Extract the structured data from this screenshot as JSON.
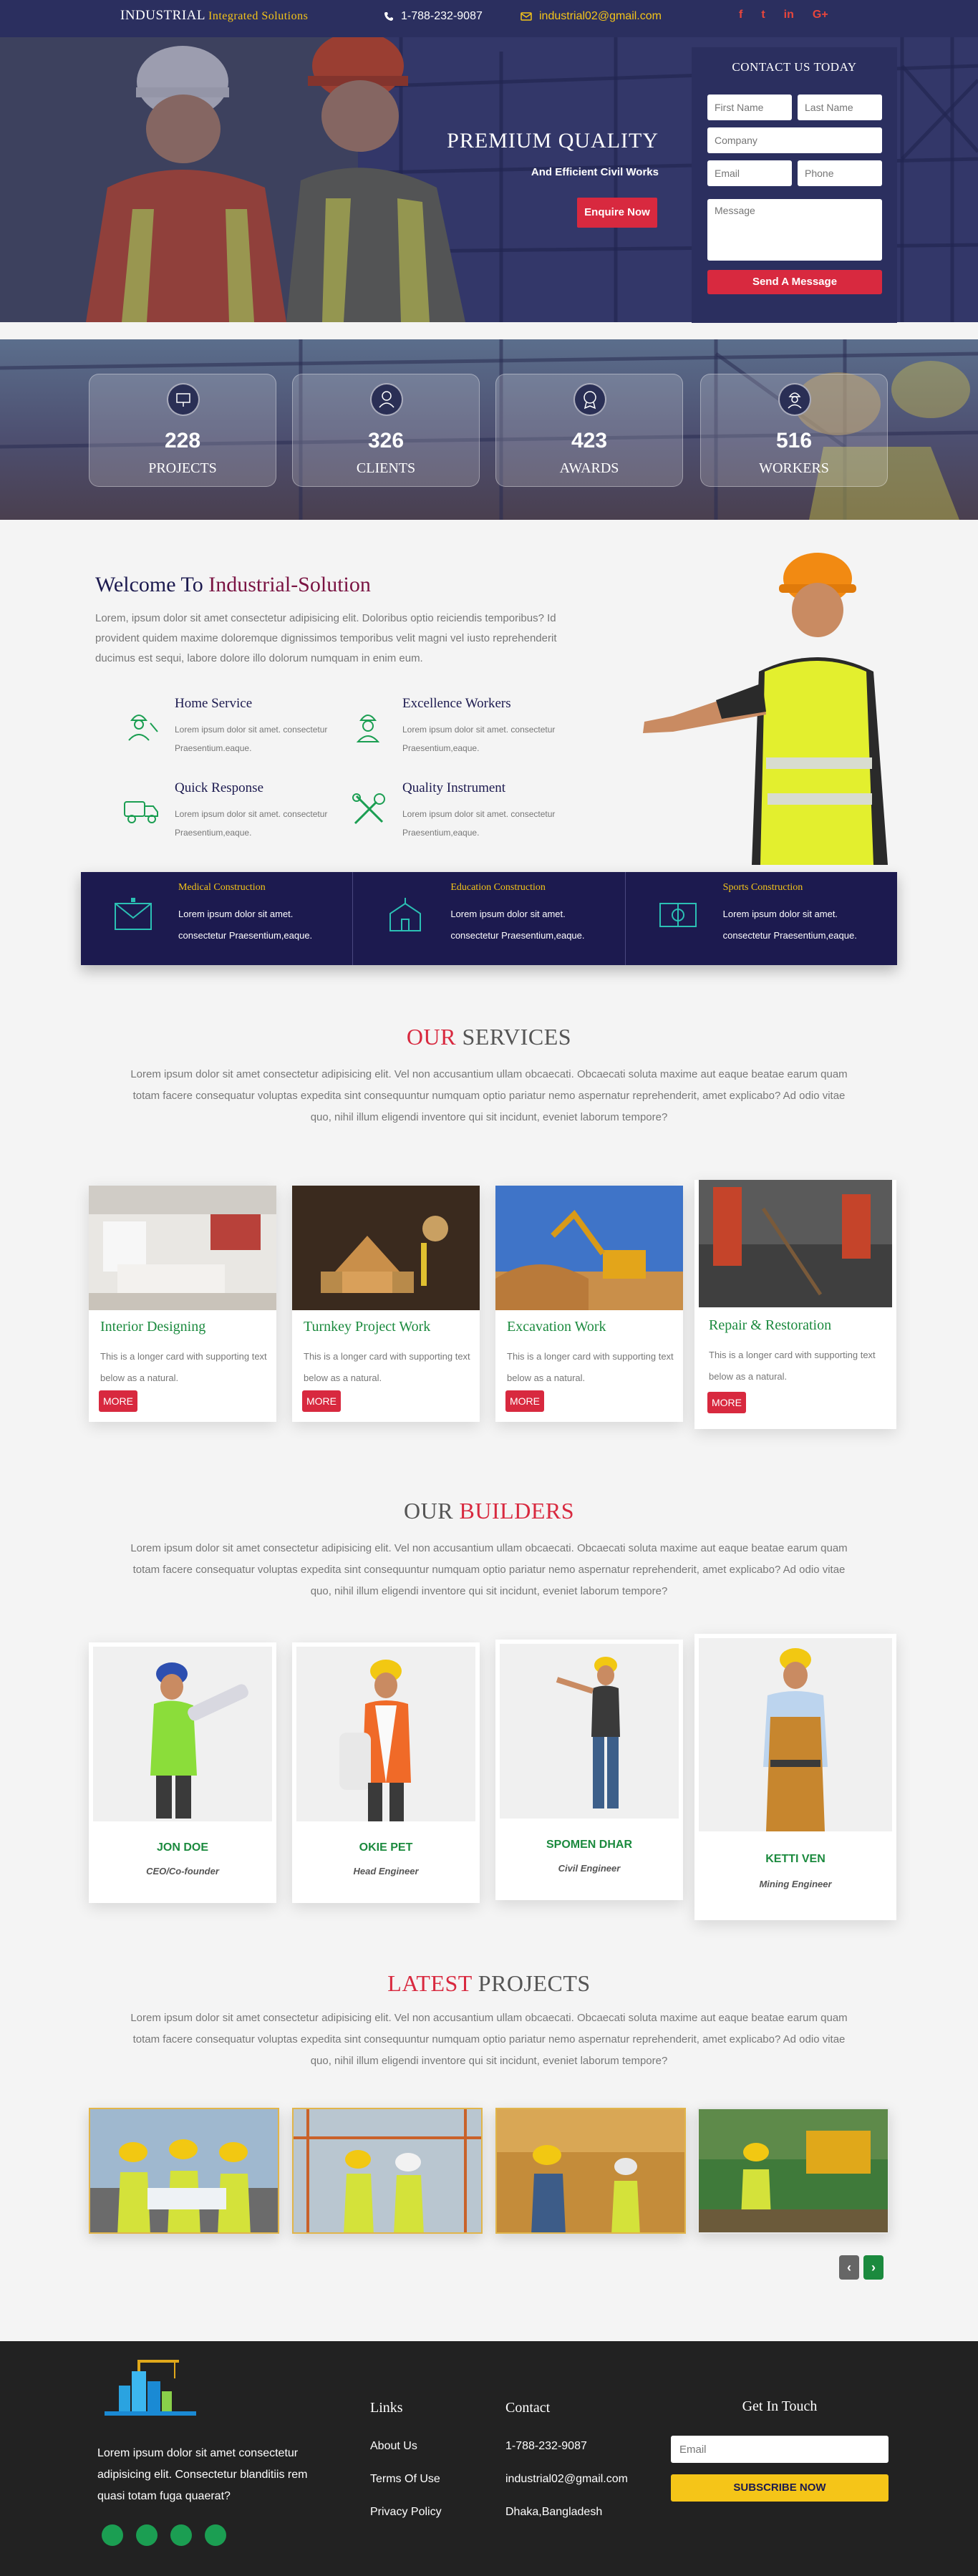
{
  "topbar": {
    "brand": "INDUSTRIAL",
    "brand_sub": "Integrated Solutions",
    "phone_icon": "phone-icon",
    "phone": "1-788-232-9087",
    "email_icon": "envelope-icon",
    "email": "industrial02@gmail.com",
    "social_icons": [
      "facebook-icon",
      "twitter-icon",
      "linkedin-icon",
      "google-plus-icon"
    ],
    "social_glyphs": [
      "f",
      "t",
      "in",
      "G+"
    ]
  },
  "hero": {
    "title": "PREMIUM QUALITY",
    "subtitle": "And Efficient Civil Works",
    "button": "Enquire Now"
  },
  "contact_form": {
    "title": "CONTACT US TODAY",
    "first_name": "First Name",
    "last_name": "Last Name",
    "company": "Company",
    "email": "Email",
    "phone": "Phone",
    "message": "Message",
    "submit": "Send A Message"
  },
  "stats": [
    {
      "value": "228",
      "label": "PROJECTS",
      "icon": "presentation-icon"
    },
    {
      "value": "326",
      "label": "CLIENTS",
      "icon": "user-icon"
    },
    {
      "value": "423",
      "label": "AWARDS",
      "icon": "award-icon"
    },
    {
      "value": "516",
      "label": "WORKERS",
      "icon": "worker-icon"
    }
  ],
  "welcome": {
    "title_prefix": "Welcome To",
    "title_highlight": "Industrial-Solution",
    "paragraph": "Lorem, ipsum dolor sit amet consectetur adipisicing elit. Doloribus optio reiciendis temporibus? Id provident quidem maxime doloremque dignissimos temporibus velit magni vel iusto reprehenderit ducimus est sequi, labore dolore illo dolorum numquam in enim eum.",
    "features": [
      {
        "title": "Home Service",
        "text": "Lorem ipsum dolor sit amet. consectetur Praesentium.eaque.",
        "icon": "worker-icon"
      },
      {
        "title": "Excellence Workers",
        "text": "Lorem ipsum dolor sit amet. consectetur Praesentium,eaque.",
        "icon": "engineer-icon"
      },
      {
        "title": "Quick Response",
        "text": "Lorem ipsum dolor sit amet. consectetur Praesentium,eaque.",
        "icon": "truck-icon"
      },
      {
        "title": "Quality Instrument",
        "text": "Lorem ipsum dolor sit amet. consectetur Praesentium,eaque.",
        "icon": "tools-icon"
      }
    ],
    "bar": [
      {
        "title": "Medical Construction",
        "text": "Lorem ipsum dolor sit amet. consectetur Praesentium,eaque.",
        "icon": "medical-mail-icon"
      },
      {
        "title": "Education Construction",
        "text": "Lorem ipsum dolor sit amet. consectetur Praesentium,eaque.",
        "icon": "school-icon"
      },
      {
        "title": "Sports Construction",
        "text": "Lorem ipsum dolor sit amet. consectetur Praesentium,eaque.",
        "icon": "stadium-icon"
      }
    ]
  },
  "services": {
    "title_red": "OUR",
    "title_rest": "SERVICES",
    "paragraph": "Lorem ipsum dolor sit amet consectetur adipisicing elit. Vel non accusantium ullam obcaecati. Obcaecati soluta maxime aut eaque beatae earum quam totam facere consequatur voluptas expedita sint consequuntur numquam optio pariatur nemo aspernatur reprehenderit, amet explicabo? Ad odio vitae quo, nihil illum eligendi inventore qui sit incidunt, eveniet laborum tempore?",
    "cards": [
      {
        "title": "Interior Designing",
        "text": "This is a longer card with supporting text below as a natural.",
        "more": "MORE"
      },
      {
        "title": "Turnkey Project Work",
        "text": "This is a longer card with supporting text below as a natural.",
        "more": "MORE"
      },
      {
        "title": "Excavation Work",
        "text": "This is a longer card with supporting text below as a natural.",
        "more": "MORE"
      },
      {
        "title": "Repair & Restoration",
        "text": "This is a longer card with supporting text below as a natural.",
        "more": "MORE"
      }
    ]
  },
  "builders": {
    "title_rest": "OUR",
    "title_red": "BUILDERS",
    "paragraph": "Lorem ipsum dolor sit amet consectetur adipisicing elit. Vel non accusantium ullam obcaecati. Obcaecati soluta maxime aut eaque beatae earum quam totam facere consequatur voluptas expedita sint consequuntur numquam optio pariatur nemo aspernatur reprehenderit, amet explicabo? Ad odio vitae quo, nihil illum eligendi inventore qui sit incidunt, eveniet laborum tempore?",
    "people": [
      {
        "name": "JON DOE",
        "role": "CEO/Co-founder"
      },
      {
        "name": "OKIE PET",
        "role": "Head Engineer"
      },
      {
        "name": "SPOMEN DHAR",
        "role": "Civil Engineer"
      },
      {
        "name": "KETTI VEN",
        "role": "Mining Engineer"
      }
    ]
  },
  "projects": {
    "title_red": "LATEST",
    "title_rest": "PROJECTS",
    "paragraph": "Lorem ipsum dolor sit amet consectetur adipisicing elit. Vel non accusantium ullam obcaecati. Obcaecati soluta maxime aut eaque beatae earum quam totam facere consequatur voluptas expedita sint consequuntur numquam optio pariatur nemo aspernatur reprehenderit, amet explicabo? Ad odio vitae quo, nihil illum eligendi inventore qui sit incidunt, eveniet laborum tempore?",
    "prev": "‹",
    "next": "›"
  },
  "footer": {
    "about": "Lorem ipsum dolor sit amet consectetur adipisicing elit. Consectetur blanditiis rem quasi totam fuga quaerat?",
    "links_title": "Links",
    "links": [
      "About Us",
      "Terms Of Use",
      "Privacy Policy"
    ],
    "contact_title": "Contact",
    "contact": [
      "1-788-232-9087",
      "industrial02@gmail.com",
      "Dhaka,Bangladesh"
    ],
    "touch_title": "Get In Touch",
    "email_placeholder": "Email",
    "subscribe": "SUBSCRIBE NOW",
    "social_icons": [
      "facebook-icon",
      "twitter-icon",
      "instagram-icon",
      "google-plus-icon"
    ]
  },
  "colors": {
    "navy": "#2b2f5f",
    "red": "#d8293f",
    "yellow": "#f5c518",
    "green": "#1b8a3e",
    "dark": "#1c1a4f"
  }
}
